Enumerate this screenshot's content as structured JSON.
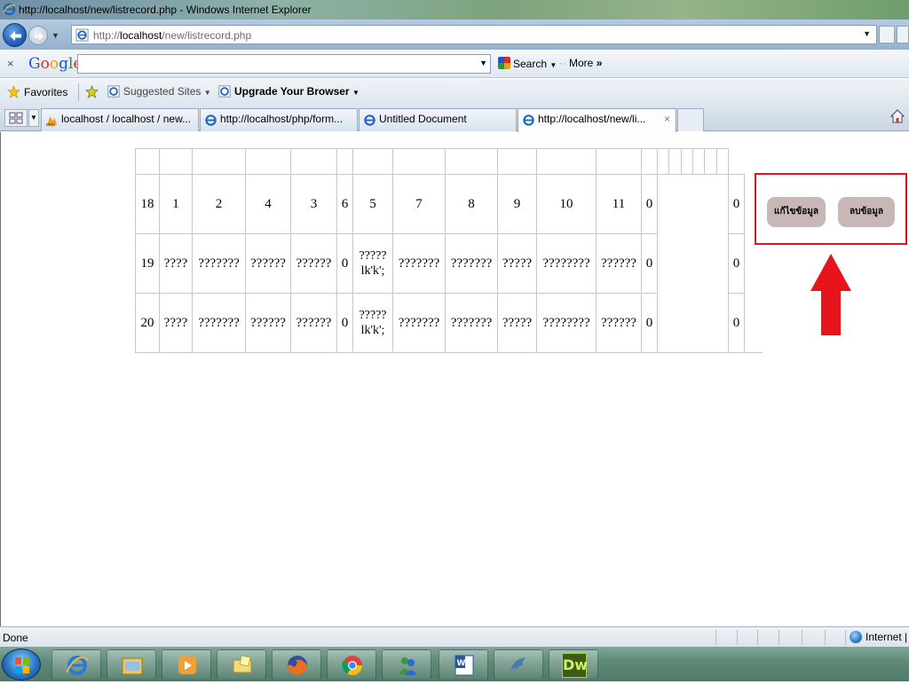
{
  "window": {
    "title": "http://localhost/new/listrecord.php - Windows Internet Explorer"
  },
  "address": {
    "url_prefix": "http://",
    "url_host": "localhost",
    "url_path": "/new/listrecord.php"
  },
  "google_toolbar": {
    "close": "×",
    "logo": {
      "g1": "G",
      "o1": "o",
      "o2": "o",
      "g2": "g",
      "l": "l",
      "e": "e"
    },
    "search_value": "",
    "search_label": "Search",
    "more_label": "More"
  },
  "favorites": {
    "favorites_label": "Favorites",
    "suggested_label": "Suggested Sites",
    "upgrade_label": "Upgrade Your Browser"
  },
  "tabs": [
    {
      "label": "localhost / localhost / new...",
      "icon": "pma-icon"
    },
    {
      "label": "http://localhost/php/form...",
      "icon": "ie-page-icon"
    },
    {
      "label": "Untitled Document",
      "icon": "ie-page-icon"
    },
    {
      "label": "http://localhost/new/li...",
      "icon": "ie-page-icon",
      "active": true,
      "close": "×"
    }
  ],
  "table": {
    "rows": [
      {
        "id": "18",
        "c1": "1",
        "c2": "2",
        "c3": "4",
        "c4": "3",
        "c5": "6",
        "c6_line1": "5",
        "c6_line2": "",
        "c7": "7",
        "c8": "8",
        "c9": "9",
        "c10": "10",
        "c11": "11",
        "c12": "0",
        "c13": "0"
      },
      {
        "id": "19",
        "c1": "????",
        "c2": "???????",
        "c3": "??????",
        "c4": "??????",
        "c5": "0",
        "c6_line1": "?????",
        "c6_line2": "lk'k';",
        "c7": "???????",
        "c8": "???????",
        "c9": "?????",
        "c10": "????????",
        "c11": "??????",
        "c12": "0",
        "c13": "0"
      },
      {
        "id": "20",
        "c1": "????",
        "c2": "???????",
        "c3": "??????",
        "c4": "??????",
        "c5": "0",
        "c6_line1": "?????",
        "c6_line2": "lk'k';",
        "c7": "???????",
        "c8": "???????",
        "c9": "?????",
        "c10": "????????",
        "c11": "??????",
        "c12": "0",
        "c13": "0"
      }
    ]
  },
  "actions": {
    "edit_label": "แก้ไขข้อมูล",
    "delete_label": "ลบข้อมูล",
    "highlight_color": "#e0141c",
    "arrow_color": "#e8141c"
  },
  "status": {
    "text": "Done",
    "zone": "Internet |"
  },
  "taskbar": {
    "apps": [
      "ie-icon",
      "explorer-icon",
      "media-player-icon",
      "folder-sticky-icon",
      "firefox-icon",
      "chrome-icon",
      "messenger-icon",
      "word-icon",
      "mysql-dolphin-icon",
      "dreamweaver-icon"
    ],
    "dreamweaver_label": "Dw"
  }
}
